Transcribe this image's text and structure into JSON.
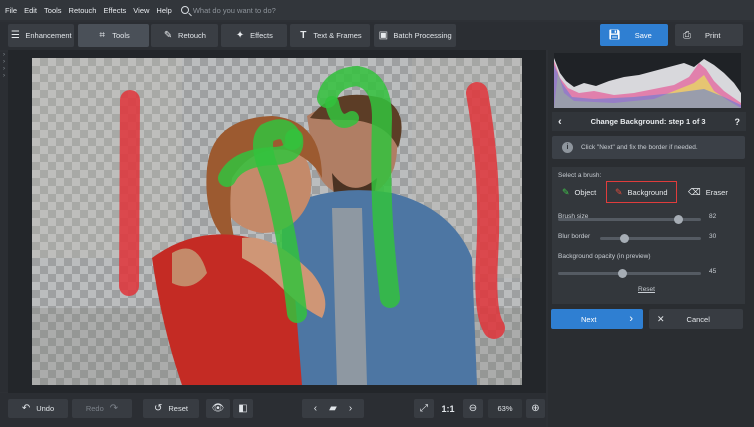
{
  "menu": {
    "items": [
      "File",
      "Edit",
      "Tools",
      "Retouch",
      "Effects",
      "View",
      "Help"
    ],
    "search_placeholder": "What do you want to do?"
  },
  "tabs": [
    {
      "label": "Enhancement",
      "icon": "sliders-icon"
    },
    {
      "label": "Tools",
      "icon": "crop-icon",
      "active": true
    },
    {
      "label": "Retouch",
      "icon": "brush-icon"
    },
    {
      "label": "Effects",
      "icon": "sparkle-icon"
    },
    {
      "label": "Text & Frames",
      "icon": "text-icon"
    },
    {
      "label": "Batch Processing",
      "icon": "images-icon"
    }
  ],
  "actions": {
    "save_label": "Save",
    "print_label": "Print"
  },
  "bottom_toolbar": {
    "undo_label": "Undo",
    "redo_label": "Redo",
    "reset_label": "Reset",
    "ratio_label": "1:1",
    "zoom_value": "63%"
  },
  "panel": {
    "step_title": "Change Background: step 1 of 3",
    "help_label": "?",
    "hint_text": "Click \"Next\" and fix the border if needed.",
    "select_brush_label": "Select a brush:",
    "brushes": [
      {
        "label": "Object",
        "color": "#3fc24a"
      },
      {
        "label": "Background",
        "color": "#e14b3b",
        "selected": true
      },
      {
        "label": "Eraser",
        "color": "#ffffff"
      }
    ],
    "sliders": [
      {
        "label": "Brush size",
        "value": "82",
        "fraction": 0.84
      },
      {
        "label": "Blur border",
        "value": "30",
        "fraction": 0.24
      },
      {
        "label": "Background opacity (in preview)",
        "value": "45",
        "fraction": 0.45
      }
    ],
    "reset_link": "Reset",
    "next_label": "Next",
    "cancel_label": "Cancel"
  },
  "colors": {
    "accent_blue": "#2f7fd2",
    "object_stroke": "#33c23d",
    "background_stroke": "#e0343a",
    "highlight_border": "#e03c3c"
  }
}
